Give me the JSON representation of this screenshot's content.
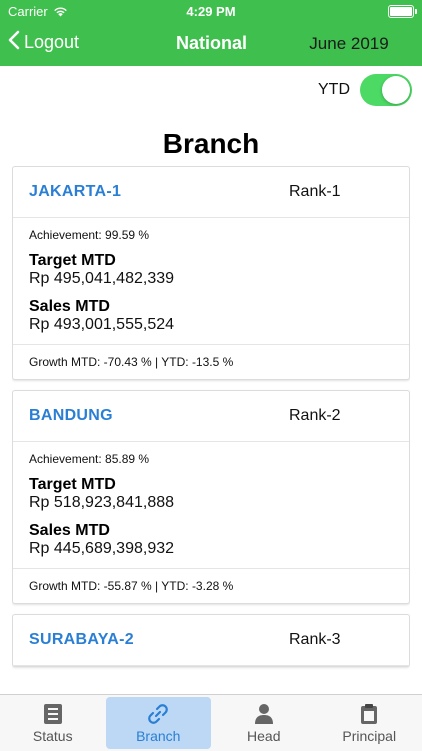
{
  "status_bar": {
    "carrier": "Carrier",
    "time": "4:29 PM"
  },
  "nav": {
    "back_label": "Logout",
    "title": "National",
    "period": "June 2019"
  },
  "ytd": {
    "label": "YTD",
    "enabled": true
  },
  "page_title": "Branch",
  "branches": [
    {
      "name": "JAKARTA-1",
      "rank": "Rank-1",
      "achievement": "Achievement: 99.59 %",
      "target_label": "Target MTD",
      "target_value": "Rp 495,041,482,339",
      "sales_label": "Sales MTD",
      "sales_value": "Rp 493,001,555,524",
      "growth": "Growth MTD: -70.43 % | YTD: -13.5 %"
    },
    {
      "name": "BANDUNG",
      "rank": "Rank-2",
      "achievement": "Achievement: 85.89 %",
      "target_label": "Target MTD",
      "target_value": "Rp 518,923,841,888",
      "sales_label": "Sales MTD",
      "sales_value": "Rp 445,689,398,932",
      "growth": "Growth MTD: -55.87 % | YTD: -3.28 %"
    },
    {
      "name": "SURABAYA-2",
      "rank": "Rank-3"
    }
  ],
  "tabs": [
    {
      "label": "Status",
      "icon": "list-icon"
    },
    {
      "label": "Branch",
      "icon": "link-icon"
    },
    {
      "label": "Head",
      "icon": "person-icon"
    },
    {
      "label": "Principal",
      "icon": "clipboard-icon"
    }
  ],
  "colors": {
    "header": "#3fbf4d",
    "accent": "#2a7fd4",
    "toggle_on": "#4cd964"
  }
}
